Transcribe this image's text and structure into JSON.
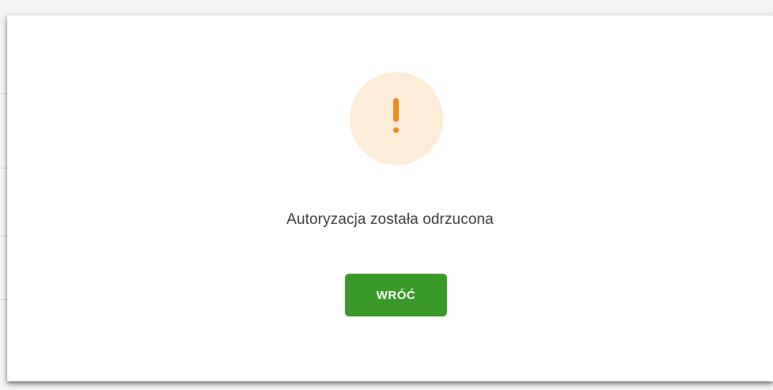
{
  "dialog": {
    "icon": "exclamation-icon",
    "message": "Autoryzacja została odrzucona",
    "back_label": "WRÓĆ"
  },
  "colors": {
    "accent_green": "#3a9a29",
    "warning_orange": "#ef8a1f",
    "warning_circle": "#fdecd8"
  }
}
